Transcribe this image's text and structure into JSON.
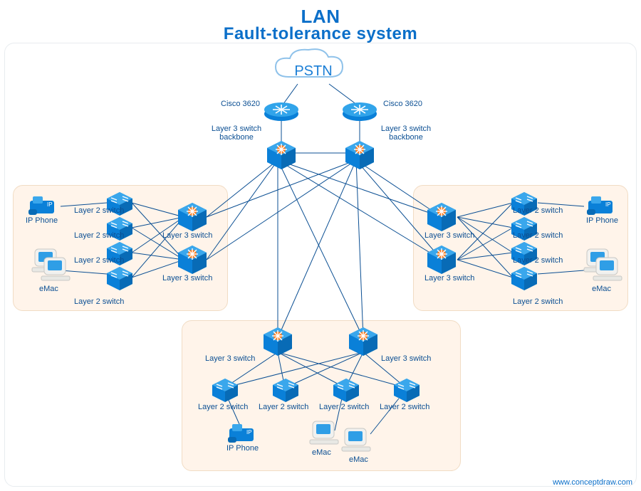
{
  "title": {
    "line1": "LAN",
    "line2": "Fault-tolerance system"
  },
  "credit": "www.conceptdraw.com",
  "cloud": "PSTN",
  "routers": {
    "r1": "Cisco 3620",
    "r2": "Cisco 3620"
  },
  "backbone": {
    "b1": "Layer 3 switch\nbackbone",
    "b2": "Layer 3 switch\nbackbone"
  },
  "leftGroup": {
    "ipphone": "IP Phone",
    "emac": "eMac",
    "l2": [
      "Layer 2 switch",
      "Layer 2 switch",
      "Layer 2 switch",
      "Layer 2 switch"
    ],
    "l3": [
      "Layer 3 switch",
      "Layer 3 switch"
    ]
  },
  "rightGroup": {
    "ipphone": "IP Phone",
    "emac": "eMac",
    "l2": [
      "Layer 2 switch",
      "Layer 2 switch",
      "Layer 2 switch",
      "Layer 2 switch"
    ],
    "l3": [
      "Layer 3 switch",
      "Layer 3 switch"
    ]
  },
  "bottomGroup": {
    "ipphone": "IP Phone",
    "emac1": "eMac",
    "emac2": "eMac",
    "l2": [
      "Layer 2 switch",
      "Layer 2 switch",
      "Layer 2 switch",
      "Layer 2 switch"
    ],
    "l3": [
      "Layer 3 switch",
      "Layer 3 switch"
    ]
  }
}
